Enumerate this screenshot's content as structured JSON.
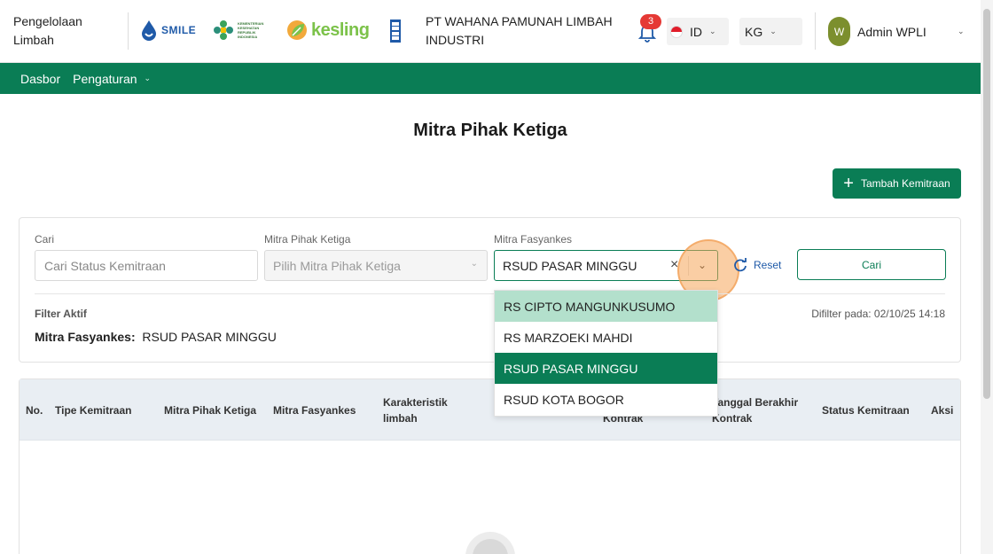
{
  "header": {
    "app_name": "Pengelolaan Limbah",
    "logos": {
      "smile": "SMILE",
      "kemkes": "KEMENTERIAN KESEHATAN REPUBLIK INDONESIA",
      "kesling": "kesling"
    },
    "company": "PT WAHANA PAMUNAH LIMBAH INDUSTRI",
    "notification_count": "3",
    "language": "ID",
    "unit": "KG",
    "user_initial": "W",
    "user_name": "Admin WPLI"
  },
  "nav": {
    "items": [
      {
        "label": "Dasbor"
      },
      {
        "label": "Pengaturan"
      }
    ]
  },
  "page": {
    "title": "Mitra Pihak Ketiga",
    "add_button": "Tambah Kemitraan"
  },
  "filters": {
    "search_label": "Cari",
    "search_placeholder": "Cari Status Kemitraan",
    "mitra_label": "Mitra Pihak Ketiga",
    "mitra_placeholder": "Pilih Mitra Pihak Ketiga",
    "fasyankes_label": "Mitra Fasyankes",
    "fasyankes_value": "RSUD PASAR MINGGU",
    "reset_label": "Reset",
    "submit_label": "Cari",
    "active_title": "Filter Aktif",
    "filtered_at": "Difilter pada: 02/10/25 14:18",
    "active_key": "Mitra Fasyankes:",
    "active_value": "RSUD PASAR MINGGU"
  },
  "dropdown": {
    "options": [
      {
        "label": "RS CIPTO MANGUNKUSUMO",
        "state": "hover"
      },
      {
        "label": "RS MARZOEKI MAHDI",
        "state": "normal"
      },
      {
        "label": "RSUD PASAR MINGGU",
        "state": "selected"
      },
      {
        "label": "RSUD KOTA BOGOR",
        "state": "normal"
      }
    ]
  },
  "table": {
    "columns": [
      "No.",
      "Tipe Kemitraan",
      "Mitra Pihak Ketiga",
      "Mitra Fasyankes",
      "Karakteristik limbah",
      "Tanggal Mulai Kontrak",
      "Tanggal Berakhir Kontrak",
      "Status Kemitraan",
      "Aksi"
    ]
  },
  "colors": {
    "primary": "#0a7d55",
    "hover": "#b3e0cc",
    "badge": "#e53935",
    "header_bg": "#e9eef3"
  }
}
